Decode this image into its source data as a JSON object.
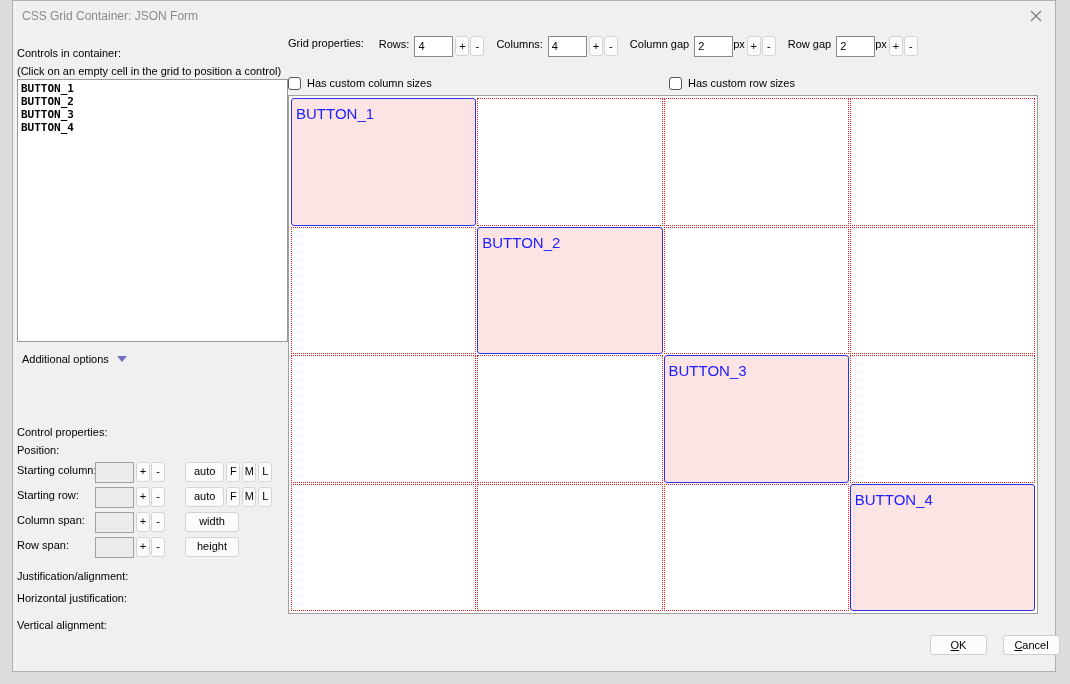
{
  "window": {
    "title": "CSS Grid Container: JSON Form"
  },
  "controls_list": {
    "label": "Controls in container:",
    "hint": "(Click on an empty cell in the grid to position a control)",
    "items": [
      "BUTTON_1",
      "BUTTON_2",
      "BUTTON_3",
      "BUTTON_4"
    ]
  },
  "additional_options": {
    "label": "Additional options",
    "expanded": false
  },
  "control_properties": {
    "title": "Control properties:",
    "position_label": "Position:",
    "rows": [
      {
        "kind": "place",
        "label": "Starting column:",
        "value": "",
        "plus": "+",
        "minus": "-",
        "buttons": [
          "auto",
          "F",
          "M",
          "L"
        ]
      },
      {
        "kind": "place",
        "label": "Starting row:",
        "value": "",
        "plus": "+",
        "minus": "-",
        "buttons": [
          "auto",
          "F",
          "M",
          "L"
        ]
      },
      {
        "kind": "span",
        "label": "Column span:",
        "value": "",
        "plus": "+",
        "minus": "-",
        "buttons": [
          "width"
        ]
      },
      {
        "kind": "span",
        "label": "Row span:",
        "value": "",
        "plus": "+",
        "minus": "-",
        "buttons": [
          "height"
        ]
      }
    ],
    "alignment_labels": [
      "Justification/alignment:",
      "Horizontal justification:",
      "Vertical alignment:"
    ]
  },
  "grid_properties": {
    "label": "Grid properties:",
    "fields": [
      {
        "label": "Rows:",
        "value": "4",
        "plus": "+",
        "minus": "-"
      },
      {
        "label": "Columns:",
        "value": "4",
        "plus": "+",
        "minus": "-"
      },
      {
        "label": "Column gap",
        "value": "2",
        "unit": "px",
        "plus": "+",
        "minus": "-"
      },
      {
        "label": "Row gap",
        "value": "2",
        "unit": "px",
        "plus": "+",
        "minus": "-"
      }
    ]
  },
  "checkboxes": [
    {
      "label": "Has custom column sizes",
      "checked": false
    },
    {
      "label": "Has custom row sizes",
      "checked": false
    }
  ],
  "grid": {
    "rows": [
      {
        "cells": [
          {
            "kind": "control",
            "label": "BUTTON_1"
          },
          {
            "kind": "empty"
          },
          {
            "kind": "empty"
          },
          {
            "kind": "empty"
          }
        ]
      },
      {
        "cells": [
          {
            "kind": "empty"
          },
          {
            "kind": "control",
            "label": "BUTTON_2"
          },
          {
            "kind": "empty"
          },
          {
            "kind": "empty"
          }
        ]
      },
      {
        "cells": [
          {
            "kind": "empty"
          },
          {
            "kind": "empty"
          },
          {
            "kind": "control",
            "label": "BUTTON_3"
          },
          {
            "kind": "empty"
          }
        ]
      },
      {
        "cells": [
          {
            "kind": "empty"
          },
          {
            "kind": "empty"
          },
          {
            "kind": "empty"
          },
          {
            "kind": "control",
            "label": "BUTTON_4"
          }
        ]
      }
    ]
  },
  "buttons": [
    {
      "label": "OK",
      "mnemonic": true
    },
    {
      "label": "Cancel",
      "mnemonic": true
    }
  ]
}
